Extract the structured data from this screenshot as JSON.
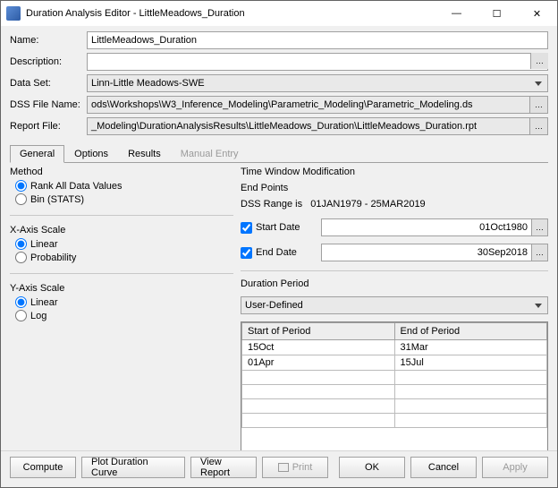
{
  "window": {
    "title": "Duration Analysis Editor - LittleMeadows_Duration"
  },
  "form": {
    "name_label": "Name:",
    "name_value": "LittleMeadows_Duration",
    "description_label": "Description:",
    "description_value": "",
    "dataset_label": "Data Set:",
    "dataset_value": "Linn-Little Meadows-SWE",
    "dssfile_label": "DSS File Name:",
    "dssfile_value": "ods\\Workshops\\W3_Inference_Modeling\\Parametric_Modeling\\Parametric_Modeling.ds",
    "reportfile_label": "Report File:",
    "reportfile_value": "_Modeling\\DurationAnalysisResults\\LittleMeadows_Duration\\LittleMeadows_Duration.rpt"
  },
  "tabs": {
    "general": "General",
    "options": "Options",
    "results": "Results",
    "manual": "Manual Entry"
  },
  "method": {
    "title": "Method",
    "rank": "Rank All Data Values",
    "bin": "Bin (STATS)"
  },
  "xaxis": {
    "title": "X-Axis Scale",
    "linear": "Linear",
    "prob": "Probability"
  },
  "yaxis": {
    "title": "Y-Axis Scale",
    "linear": "Linear",
    "log": "Log"
  },
  "timewin": {
    "title": "Time Window Modification",
    "endpoints": "End Points",
    "range_label": "DSS Range is",
    "range_value": "01JAN1979 - 25MAR2019",
    "startdate_label": "Start Date",
    "startdate_value": "01Oct1980",
    "enddate_label": "End Date",
    "enddate_value": "30Sep2018"
  },
  "duration": {
    "title": "Duration Period",
    "selector": "User-Defined",
    "col_start": "Start of Period",
    "col_end": "End of Period",
    "rows": [
      {
        "start": "15Oct",
        "end": "31Mar"
      },
      {
        "start": "01Apr",
        "end": "15Jul"
      }
    ]
  },
  "buttons": {
    "compute": "Compute",
    "plot": "Plot Duration Curve",
    "view": "View Report",
    "print": "Print",
    "ok": "OK",
    "cancel": "Cancel",
    "apply": "Apply"
  }
}
